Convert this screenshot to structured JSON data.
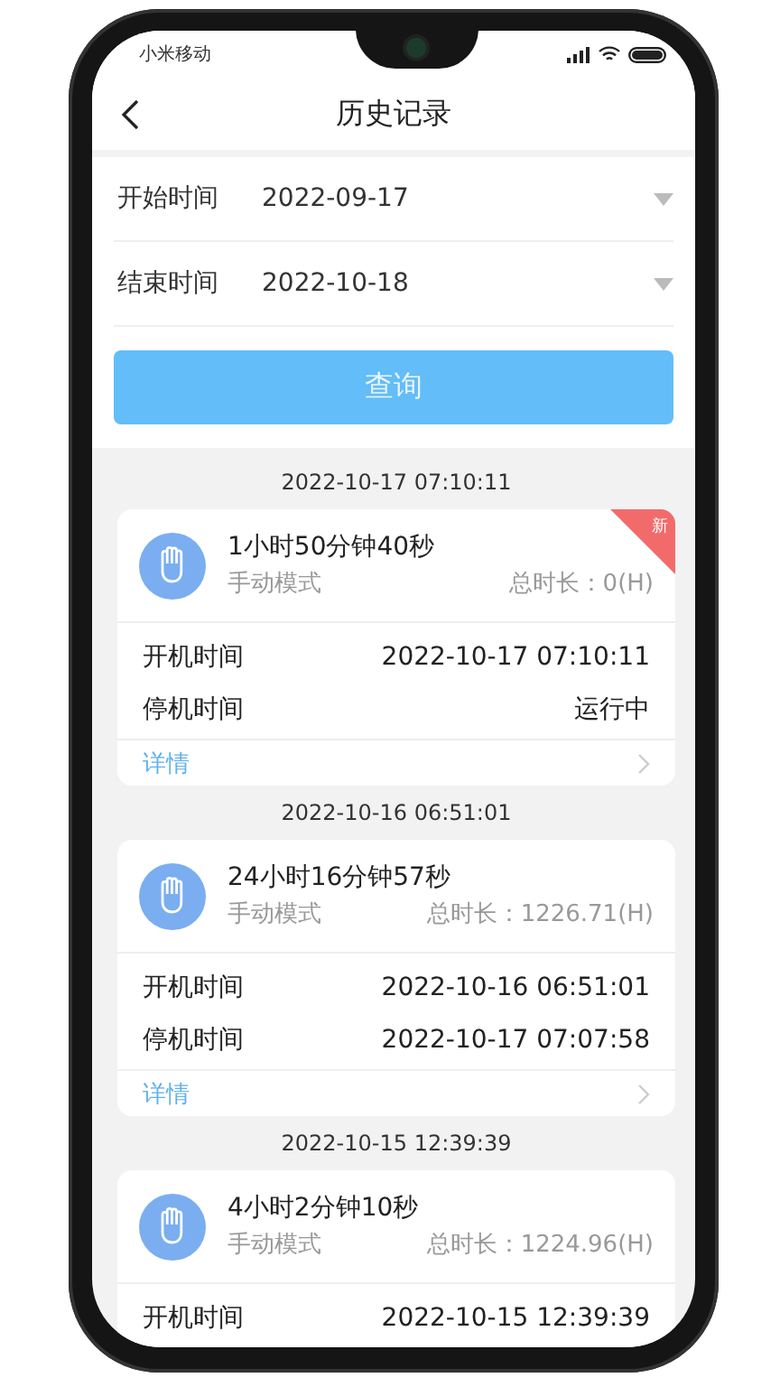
{
  "status_bar": {
    "carrier": "小米移动"
  },
  "header": {
    "title": "历史记录"
  },
  "filters": [
    {
      "label": "开始时间",
      "value": "2022-09-17"
    },
    {
      "label": "结束时间",
      "value": "2022-10-18"
    }
  ],
  "query_button": "查询",
  "records": [
    {
      "timestamp": "2022-10-17 07:10:11",
      "duration": "1小时50分钟40秒",
      "mode": "手动模式",
      "total": "总时长：0(H)",
      "badge": "新",
      "rows": [
        {
          "label": "开机时间",
          "value": "2022-10-17 07:10:11"
        },
        {
          "label": "停机时间",
          "value": "运行中"
        }
      ],
      "details": "详情"
    },
    {
      "timestamp": "2022-10-16 06:51:01",
      "duration": "24小时16分钟57秒",
      "mode": "手动模式",
      "total": "总时长：1226.71(H)",
      "rows": [
        {
          "label": "开机时间",
          "value": "2022-10-16 06:51:01"
        },
        {
          "label": "停机时间",
          "value": "2022-10-17 07:07:58"
        }
      ],
      "details": "详情"
    },
    {
      "timestamp": "2022-10-15 12:39:39",
      "duration": "4小时2分钟10秒",
      "mode": "手动模式",
      "total": "总时长：1224.96(H)",
      "rows": [
        {
          "label": "开机时间",
          "value": "2022-10-15 12:39:39"
        }
      ]
    }
  ]
}
